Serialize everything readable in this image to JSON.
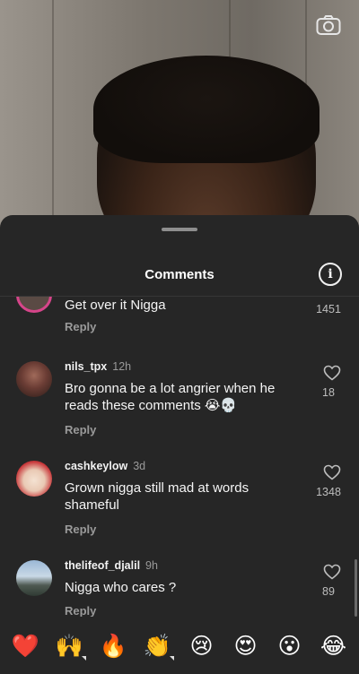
{
  "sheet": {
    "title": "Comments"
  },
  "comments": [
    {
      "username": "",
      "time": "",
      "text": "Get over it Nigga",
      "reply_label": "Reply",
      "likes": "1451"
    },
    {
      "username": "nils_tpx",
      "time": "12h",
      "text": "Bro gonna be a lot angrier when he reads these comments 😭💀",
      "reply_label": "Reply",
      "likes": "18"
    },
    {
      "username": "cashkeylow",
      "time": "3d",
      "text": "Grown nigga still mad at words shameful",
      "reply_label": "Reply",
      "likes": "1348"
    },
    {
      "username": "thelifeof_djalil",
      "time": "9h",
      "text": "Nigga who cares ?",
      "reply_label": "Reply",
      "likes": "89"
    }
  ],
  "emoji_reactions": [
    "❤️",
    "🙌",
    "🔥",
    "👏",
    "😢",
    "😍",
    "😮",
    "😂"
  ],
  "icons": {
    "camera": "camera-icon",
    "info": "info-icon",
    "like": "heart-outline-icon"
  },
  "colors": {
    "sheet_bg": "#262626",
    "muted_text": "#9a9a9a"
  }
}
